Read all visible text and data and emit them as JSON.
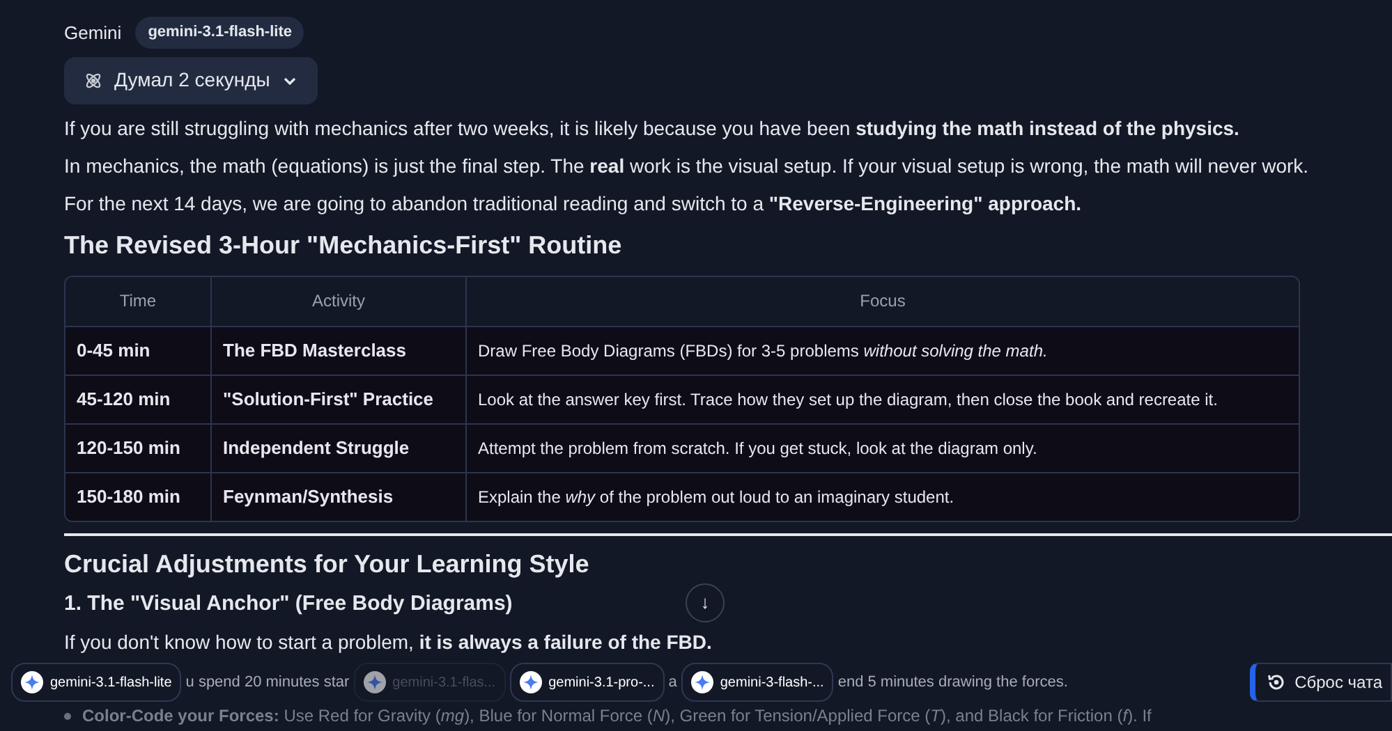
{
  "header": {
    "name": "Gemini",
    "model_badge": "gemini-3.1-flash-lite"
  },
  "thinking_toggle": {
    "label": "Думал 2 секунды",
    "expanded": false
  },
  "paragraphs": [
    "If you are still struggling with mechanics after two weeks, it is likely because you have been **studying the math instead of the physics.**",
    "In mechanics, the math (equations) is just the final step. The **real** work is the visual setup. If your visual setup is wrong, the math will never work.",
    "For the next 14 days, we are going to abandon traditional reading and switch to a **\"Reverse-Engineering\" approach.**"
  ],
  "heading": "The Revised 3-Hour \"Mechanics-First\" Routine",
  "table": {
    "columns": [
      "Time",
      "Activity",
      "Focus"
    ],
    "rows": [
      {
        "cells": [
          "0-45 min",
          "The FBD Masterclass",
          "Draw Free Body Diagrams (FBDs) for 3-5 problems *without solving the math.*"
        ]
      },
      {
        "cells": [
          "45-120 min",
          "\"Solution-First\" Practice",
          "Look at the answer key first. Trace how they set up the diagram, then close the book and recreate it."
        ]
      },
      {
        "cells": [
          "120-150 min",
          "Independent Struggle",
          "Attempt the problem from scratch. If you get stuck, look at the diagram only."
        ]
      },
      {
        "cells": [
          "150-180 min",
          "Feynman/Synthesis",
          "Explain the *why* of the problem out loud to an imaginary student."
        ]
      }
    ]
  },
  "section_heading": "Crucial Adjustments for Your Learning Style",
  "subheading": "1. The \"Visual Anchor\" (Free Body Diagrams)",
  "section_paragraph": "If you don't know how to start a problem, **it is always a failure of the FBD.**",
  "scroll_button": {
    "label": "↓"
  },
  "bottom_bar": [
    {
      "kind": "chip",
      "label": "gemini-3.1-flash-lite",
      "dimmed": false
    },
    {
      "kind": "text",
      "text": "u spend 20 minutes star"
    },
    {
      "kind": "chip",
      "label": "gemini-3.1-flas...",
      "dimmed": true
    },
    {
      "kind": "chip",
      "label": "gemini-3.1-pro-...",
      "dimmed": false
    },
    {
      "kind": "text",
      "text": "a"
    },
    {
      "kind": "chip",
      "label": "gemini-3-flash-...",
      "dimmed": false
    },
    {
      "kind": "text",
      "text": "end 5 minutes drawing the forces."
    }
  ],
  "reset_button": {
    "label": "Сброс чата"
  },
  "covered_bullet": "**Color-Code your Forces:** Use Red for Gravity (*mg*), Blue for Normal Force (*N*), Green for Tension/Applied Force (*T*), and Black for Friction (*f*). If"
}
